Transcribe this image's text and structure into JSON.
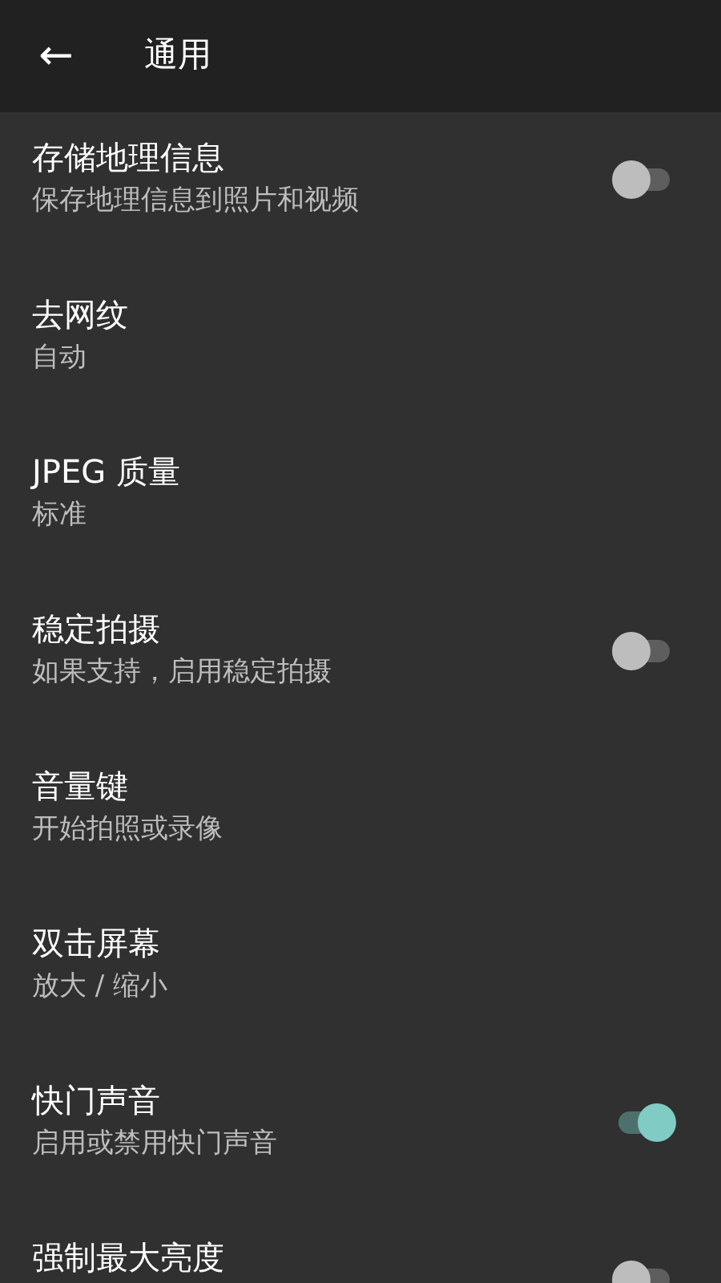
{
  "header": {
    "back_icon": "←",
    "title": "通用"
  },
  "settings": [
    {
      "kind": "switch",
      "title": "存储地理信息",
      "subtitle": "保存地理信息到照片和视频",
      "on": false
    },
    {
      "kind": "plain",
      "title": "去网纹",
      "subtitle": "自动"
    },
    {
      "kind": "plain",
      "title": "JPEG 质量",
      "subtitle": "标准"
    },
    {
      "kind": "switch",
      "title": "稳定拍摄",
      "subtitle": "如果支持，启用稳定拍摄",
      "on": false
    },
    {
      "kind": "plain",
      "title": "音量键",
      "subtitle": "开始拍照或录像"
    },
    {
      "kind": "plain",
      "title": "双击屏幕",
      "subtitle": "放大 / 缩小"
    },
    {
      "kind": "switch",
      "title": "快门声音",
      "subtitle": "启用或禁用快门声音",
      "on": true
    },
    {
      "kind": "switch",
      "title": "强制最大亮度",
      "on": false
    }
  ]
}
